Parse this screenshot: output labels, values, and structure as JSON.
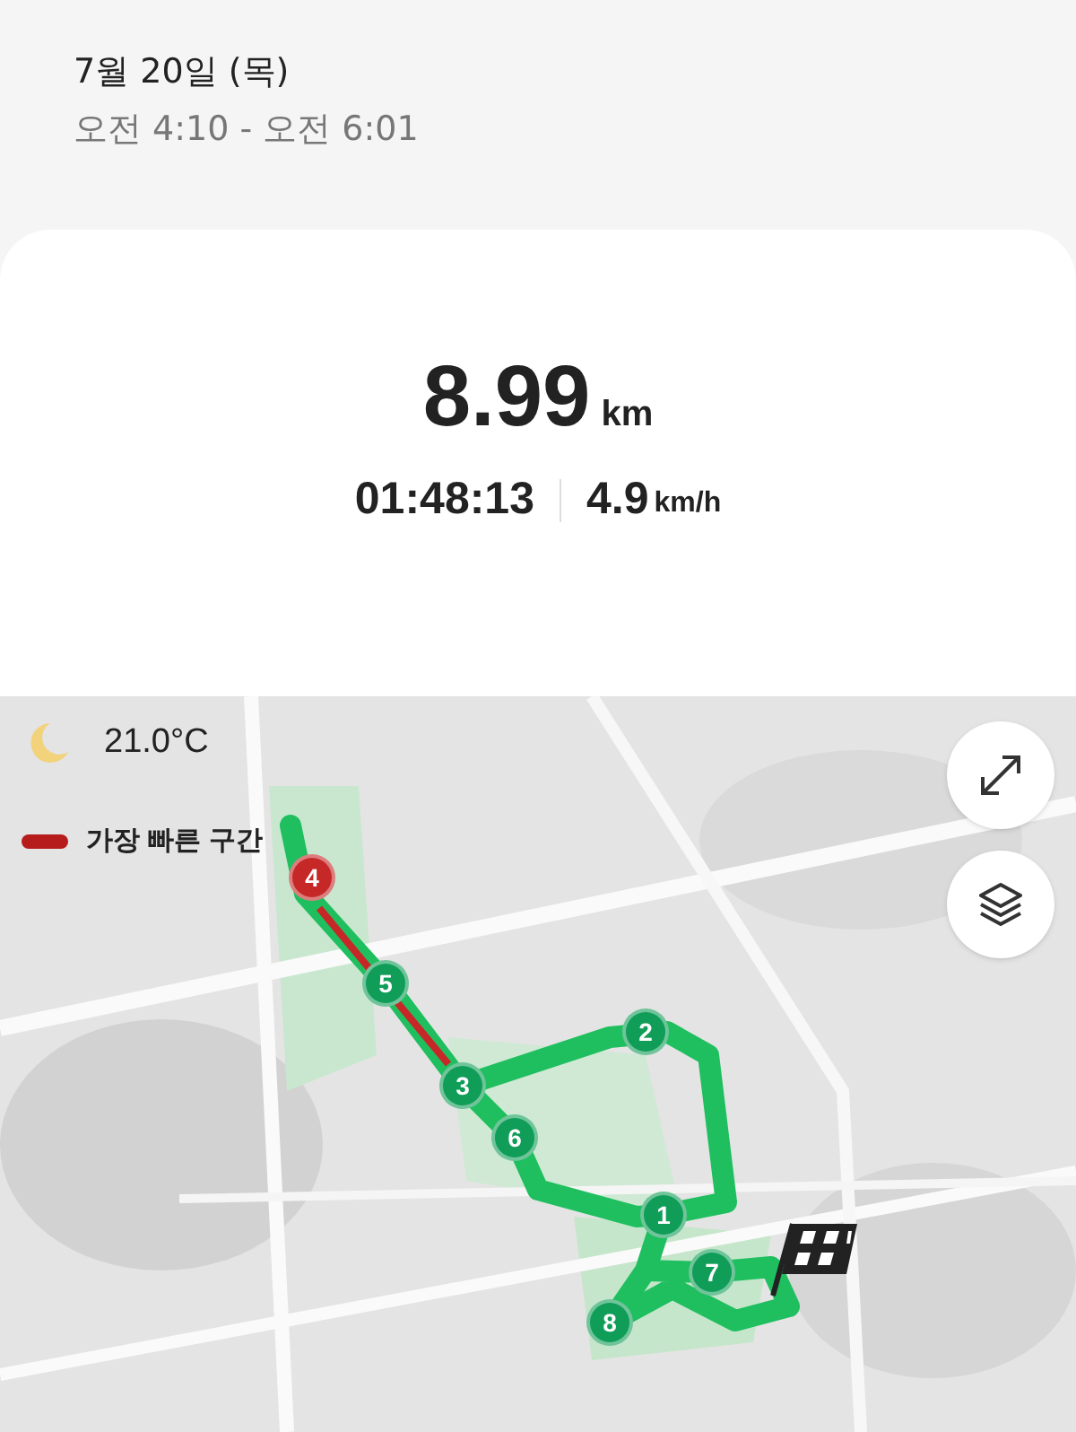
{
  "header": {
    "date": "7월 20일 (목)",
    "time_range": "오전 4:10 - 오전 6:01"
  },
  "summary": {
    "distance": "8.99",
    "distance_unit": "km",
    "duration": "01:48:13",
    "speed": "4.9",
    "speed_unit": "km/h"
  },
  "map": {
    "weather": "21.0°C",
    "legend": "가장 빠른 구간",
    "markers": [
      {
        "label": "1",
        "color": "#0f9d58"
      },
      {
        "label": "2",
        "color": "#0f9d58"
      },
      {
        "label": "3",
        "color": "#0f9d58"
      },
      {
        "label": "4",
        "color": "#c62828"
      },
      {
        "label": "5",
        "color": "#0f9d58"
      },
      {
        "label": "6",
        "color": "#0f9d58"
      },
      {
        "label": "7",
        "color": "#0f9d58"
      },
      {
        "label": "8",
        "color": "#0f9d58"
      }
    ]
  }
}
